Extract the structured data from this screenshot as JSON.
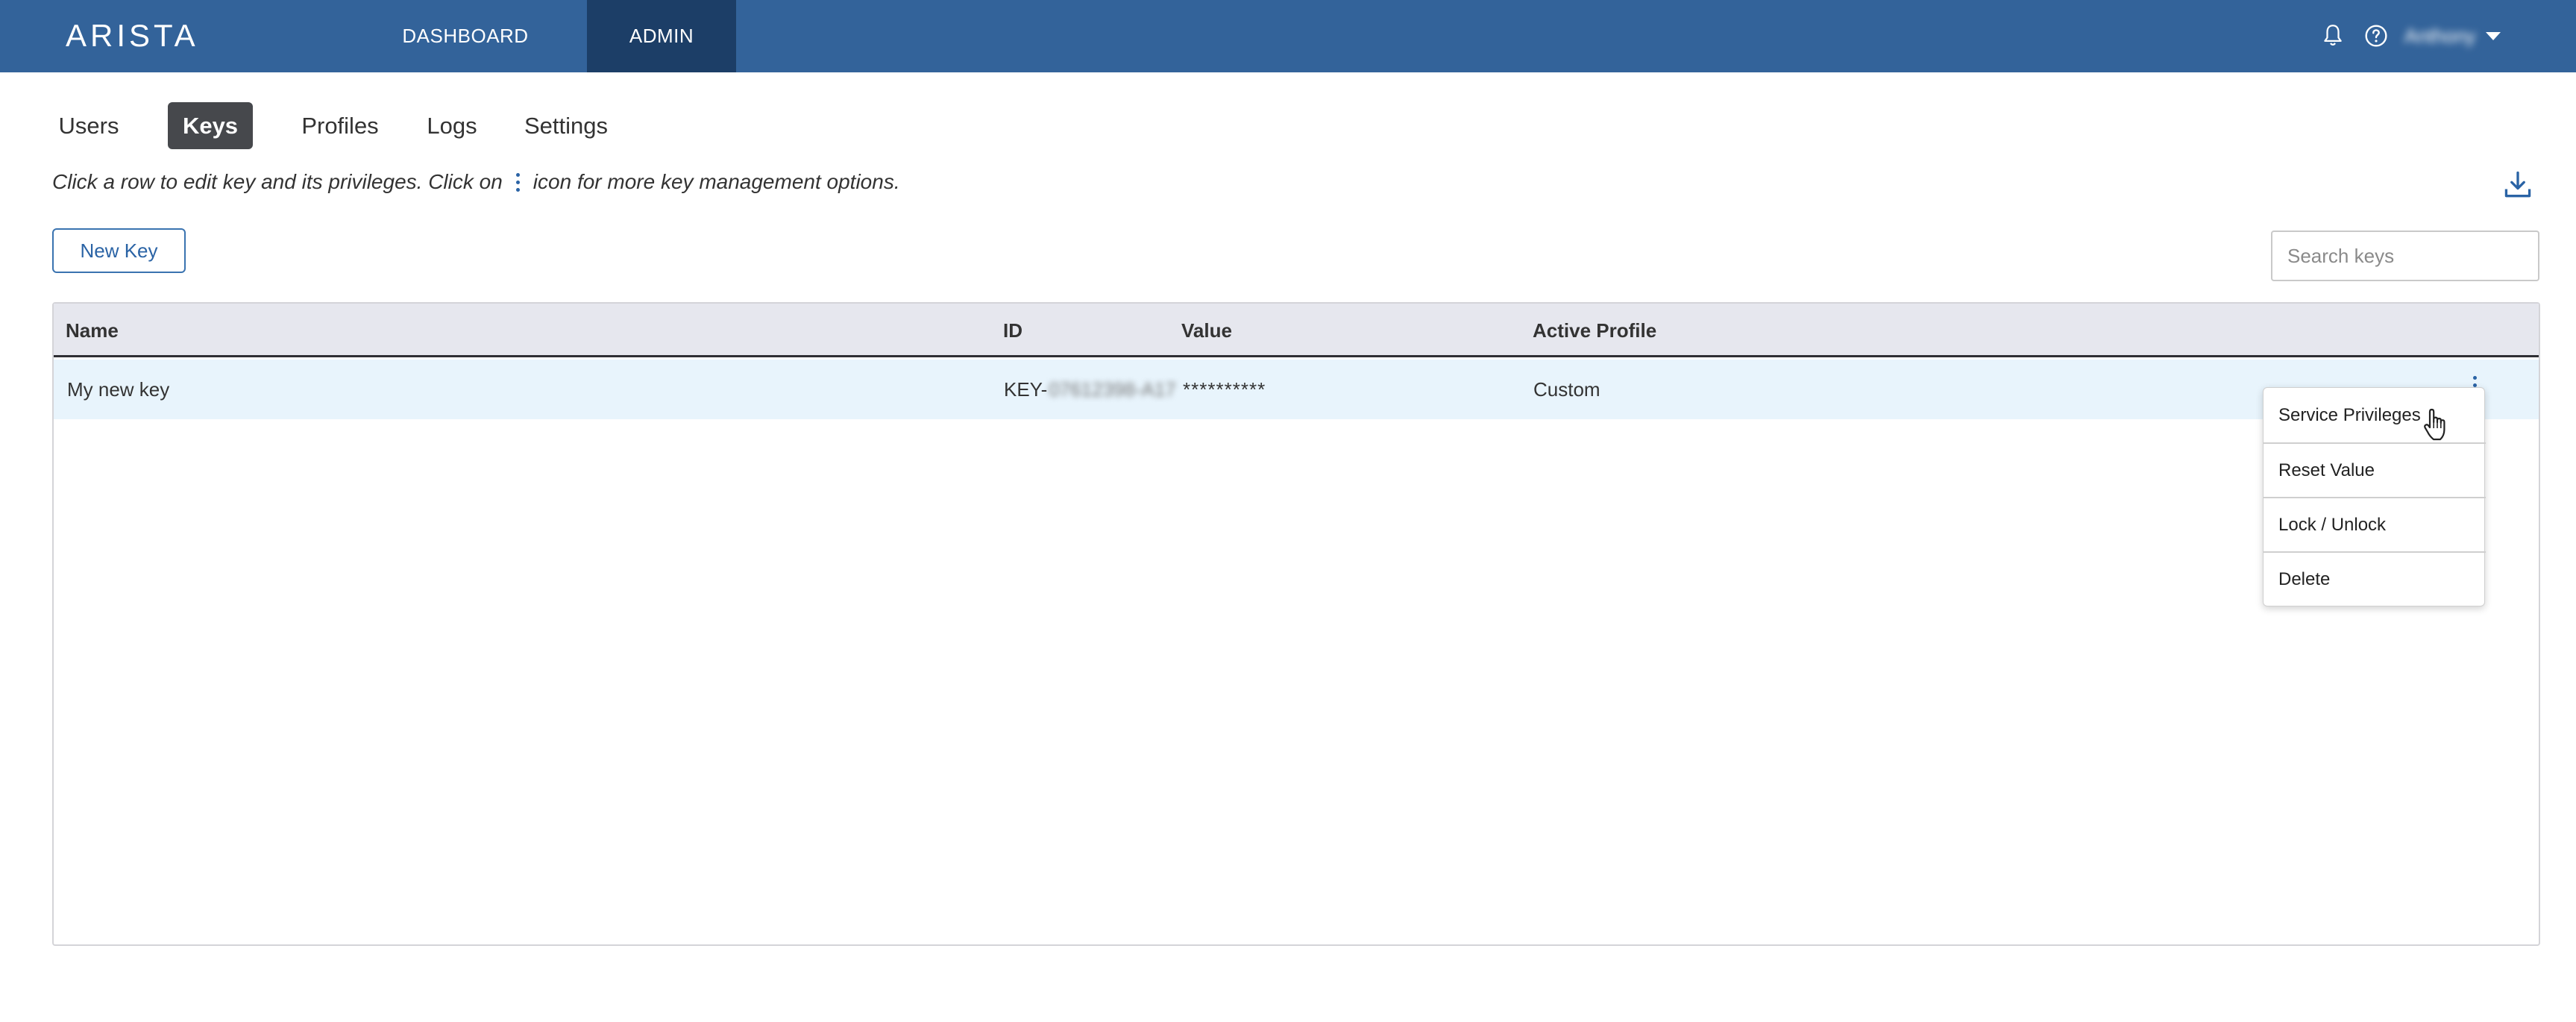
{
  "header": {
    "logo_text": "ARISTA",
    "nav": [
      {
        "label": "DASHBOARD",
        "active": false
      },
      {
        "label": "ADMIN",
        "active": true
      }
    ],
    "user_name": "Anthony",
    "icons": [
      "bell-icon",
      "help-icon",
      "caret-down-icon"
    ],
    "colors": {
      "bar": "#33639a",
      "active_nav": "#1c3e67"
    }
  },
  "tabs": [
    {
      "label": "Users",
      "active": false
    },
    {
      "label": "Keys",
      "active": true
    },
    {
      "label": "Profiles",
      "active": false
    },
    {
      "label": "Logs",
      "active": false
    },
    {
      "label": "Settings",
      "active": false
    }
  ],
  "hint": {
    "before": "Click a row to edit key and its privileges. Click on",
    "after": "icon for more key management options."
  },
  "toolbar": {
    "new_key_label": "New Key",
    "search_placeholder": "Search keys",
    "download_icon": "download-icon"
  },
  "table": {
    "columns": [
      "Name",
      "ID",
      "Value",
      "Active Profile"
    ],
    "rows": [
      {
        "name": "My new key",
        "id_prefix": "KEY-",
        "id_hidden": "07612398-A17",
        "value": "**********",
        "profile": "Custom"
      }
    ]
  },
  "context_menu": {
    "items": [
      "Service Privileges",
      "Reset Value",
      "Lock / Unlock",
      "Delete"
    ]
  }
}
